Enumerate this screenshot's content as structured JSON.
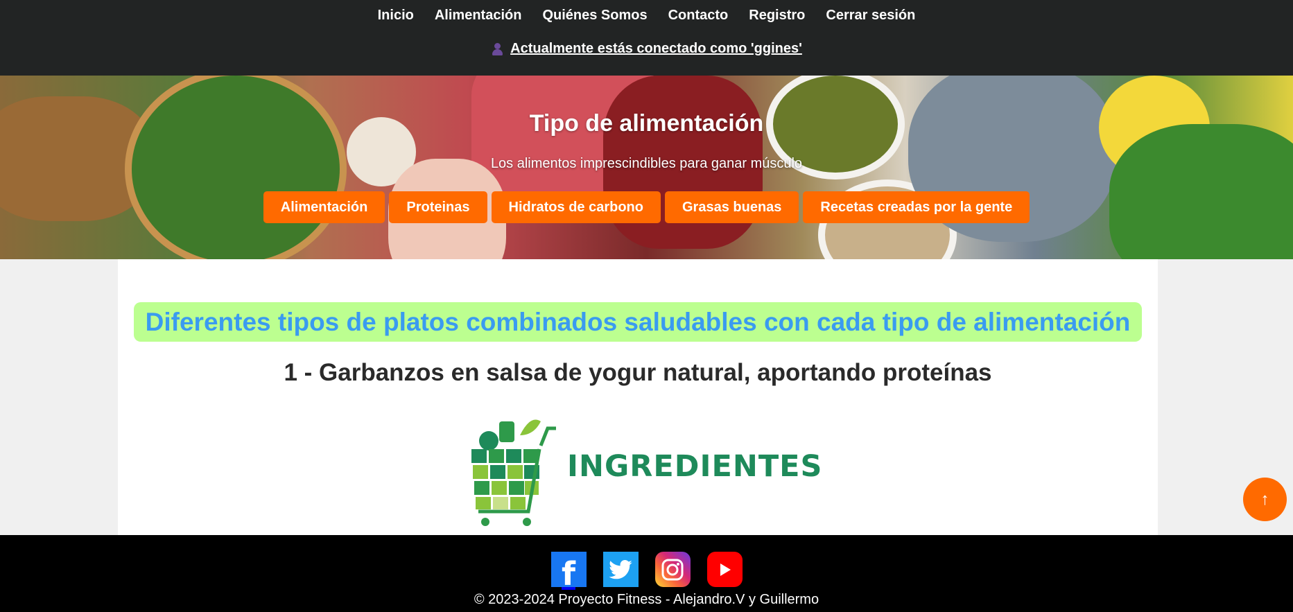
{
  "nav": {
    "items": [
      {
        "label": "Inicio"
      },
      {
        "label": "Alimentación"
      },
      {
        "label": "Quiénes Somos"
      },
      {
        "label": "Contacto"
      },
      {
        "label": "Registro"
      },
      {
        "label": "Cerrar sesión"
      }
    ],
    "user_status": "Actualmente estás conectado como 'ggines'",
    "user_icon": "user-icon"
  },
  "hero": {
    "title": "Tipo de alimentación",
    "subtitle": "Los alimentos imprescindibles para ganar músculo",
    "buttons": [
      {
        "label": "Alimentación"
      },
      {
        "label": "Proteinas"
      },
      {
        "label": "Hidratos de carbono"
      },
      {
        "label": "Grasas buenas"
      },
      {
        "label": "Recetas creadas por la gente"
      }
    ],
    "button_color": "#ff6a00"
  },
  "main": {
    "banner_title": "Diferentes tipos de platos combinados saludables con cada tipo de alimentación",
    "dish_title": "1 - Garbanzos en salsa de yogur natural, aportando proteínas",
    "ingredients_logo_text": "INGREDIENTES",
    "banner_bg": "#bcff90",
    "banner_text_color": "#3a9bf0"
  },
  "scroll_top": {
    "icon": "arrow-up-icon"
  },
  "footer": {
    "socials": [
      {
        "name": "facebook-icon"
      },
      {
        "name": "twitter-icon"
      },
      {
        "name": "instagram-icon"
      },
      {
        "name": "youtube-icon"
      }
    ],
    "copyright": "© 2023-2024 Proyecto Fitness - Alejandro.V y Guillermo"
  }
}
